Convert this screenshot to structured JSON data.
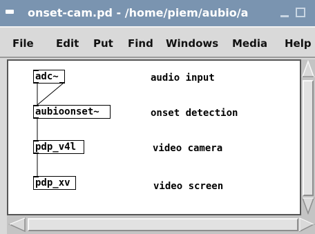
{
  "window": {
    "title": "onset-cam.pd  - /home/piem/aubio/a",
    "title_color": "#7a94b0"
  },
  "menubar": {
    "items": [
      "File",
      "Edit",
      "Put",
      "Find",
      "Windows",
      "Media",
      "Help"
    ]
  },
  "canvas": {
    "objects": [
      {
        "text": "adc~"
      },
      {
        "text": "aubioonset~"
      },
      {
        "text": "pdp_v4l"
      },
      {
        "text": "pdp_xv"
      }
    ],
    "comments": [
      {
        "text": "audio input"
      },
      {
        "text": "onset detection"
      },
      {
        "text": "video camera"
      },
      {
        "text": "video screen"
      }
    ]
  },
  "icons": {
    "window_menu": "window-menu-icon",
    "minimize": "minimize-icon",
    "maximize": "maximize-icon",
    "scroll_up": "arrow-up-icon",
    "scroll_down": "arrow-down-icon",
    "scroll_left": "arrow-left-icon",
    "scroll_right": "arrow-right-icon"
  }
}
